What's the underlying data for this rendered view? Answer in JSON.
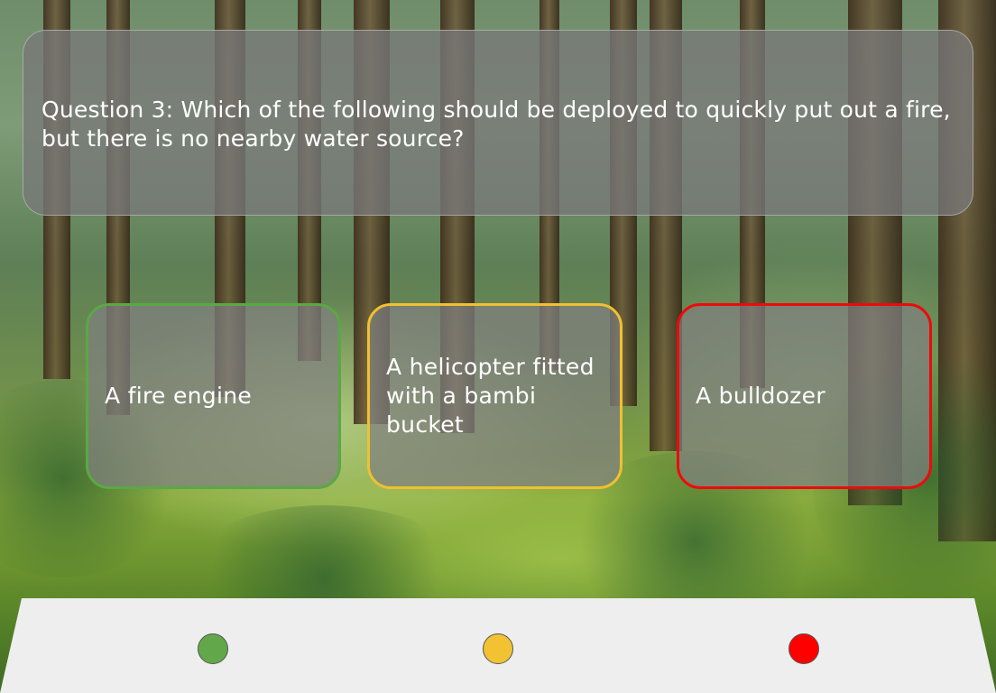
{
  "question": {
    "text": "Question 3: Which of the following should be deployed to quickly put out a fire, but there is no nearby water source?"
  },
  "answers": [
    {
      "label": "A fire engine",
      "color": "#5aa845"
    },
    {
      "label": "A helicopter fitted with a bambi bucket",
      "color": "#f0c030"
    },
    {
      "label": "A bulldozer",
      "color": "#ee0a0a"
    }
  ],
  "buttons": [
    {
      "color": "#62a84a",
      "name": "green"
    },
    {
      "color": "#f2c232",
      "name": "yellow"
    },
    {
      "color": "#ff0000",
      "name": "red"
    }
  ],
  "background": "forest"
}
